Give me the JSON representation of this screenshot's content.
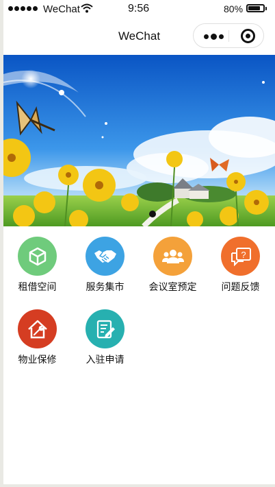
{
  "status_bar": {
    "carrier": "WeChat",
    "time": "9:56",
    "battery_percent": "80%",
    "battery_level": 0.8
  },
  "nav": {
    "title": "WeChat"
  },
  "banner": {
    "slide_count": 1,
    "active_slide": 1
  },
  "menu": [
    {
      "label": "租借空间",
      "icon": "cube-icon",
      "color": "#6fcb7c"
    },
    {
      "label": "服务集市",
      "icon": "handshake-icon",
      "color": "#3da3e3"
    },
    {
      "label": "会议室预定",
      "icon": "people-group-icon",
      "color": "#f4a13a"
    },
    {
      "label": "问题反馈",
      "icon": "question-chat-icon",
      "color": "#f06f2c"
    },
    {
      "label": "物业保修",
      "icon": "house-wrench-icon",
      "color": "#d53d22"
    },
    {
      "label": "入驻申请",
      "icon": "edit-document-icon",
      "color": "#27b0b0"
    }
  ]
}
